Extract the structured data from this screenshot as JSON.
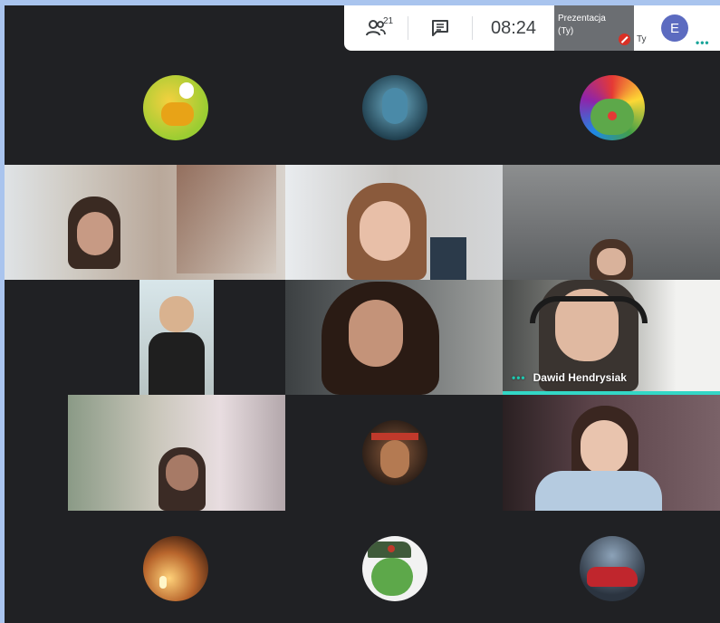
{
  "header": {
    "participants_count": "21",
    "clock": "08:24",
    "presentation_label": "Prezentacja",
    "presentation_owner": "(Ty)",
    "self_label": "Ty",
    "self_initial": "E",
    "more_glyph": "•••"
  },
  "tiles": [
    {
      "type": "avatar",
      "icon": "adventure-time-avatar"
    },
    {
      "type": "avatar",
      "icon": "avatar-movie-avatar"
    },
    {
      "type": "avatar",
      "icon": "clown-pepe-avatar"
    },
    {
      "type": "video"
    },
    {
      "type": "video"
    },
    {
      "type": "video"
    },
    {
      "type": "video"
    },
    {
      "type": "video"
    },
    {
      "type": "video",
      "name": "Dawid Hendrysiak",
      "speaking": true
    },
    {
      "type": "video"
    },
    {
      "type": "avatar",
      "icon": "game-character-avatar"
    },
    {
      "type": "video"
    },
    {
      "type": "avatar",
      "icon": "candle-figure-avatar"
    },
    {
      "type": "avatar",
      "icon": "pepe-soldier-avatar"
    },
    {
      "type": "avatar",
      "icon": "red-car-avatar"
    }
  ],
  "speaking_name_dots": "•••",
  "colors": {
    "background": "#202124",
    "accent_teal": "#33d7c6",
    "self_avatar": "#5c6bc0",
    "mute_red": "#d93025",
    "frame_blue": "#a9c4ee"
  }
}
